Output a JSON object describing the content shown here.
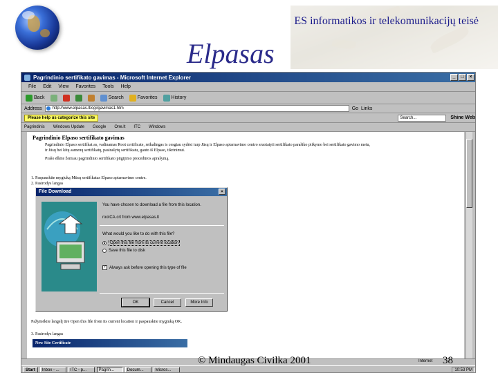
{
  "slide": {
    "header_title": "ES informatikos ir telekomunikacijų teisė",
    "title": "Elpasas",
    "footer_author": "© Mindaugas Civilka 2001",
    "page_number": "38"
  },
  "browser": {
    "window_title": "Pagrindinio sertifikato gavimas - Microsoft Internet Explorer",
    "menu": [
      "File",
      "Edit",
      "View",
      "Favorites",
      "Tools",
      "Help"
    ],
    "toolbar": [
      {
        "label": "Back",
        "icon": "back-arrow-icon"
      },
      {
        "label": "",
        "icon": "forward-arrow-icon"
      },
      {
        "label": "",
        "icon": "stop-icon"
      },
      {
        "label": "",
        "icon": "refresh-icon"
      },
      {
        "label": "",
        "icon": "home-icon"
      },
      {
        "label": "Search",
        "icon": "search-icon"
      },
      {
        "label": "Favorites",
        "icon": "favorites-icon"
      },
      {
        "label": "History",
        "icon": "history-icon"
      }
    ],
    "address_label": "Address",
    "address_url": "http://www.elpasas.lt/cgi/gavimas1.htm",
    "go_label": "Go",
    "links_label": "Links",
    "categorize_button": "Please help us categorize this site",
    "search_placeholder": "Search...",
    "shine_web": "Shine Web",
    "links": [
      "Pagrindinis",
      "Windows Update",
      "Google",
      "One.lt",
      "ITC",
      "Windows"
    ],
    "status_zone": "Internet",
    "colors": {
      "titlebar": "#08246b",
      "accent": "#3a6ea5"
    }
  },
  "content": {
    "heading": "Pagrindinio Elpaso sertifikato gavimas",
    "para_lines": [
      "Pagrindinio Elpaso sertifikat as, vadinamas Root certificate, reikalingas is cesgiau sydėsi turp Jūsų ir Elpaso aptarnavimo centro sruotatyti sertifikato parašiko piikymo bei sertifikato gavimo metu,",
      "ir Jūsų bei kitų asmenų sertifikatų, pasirašytų sertifikatu, gauto iš Elpaso, tikrinimui.",
      "Prašo ėlkite žemiau pagrindinio sertifikato piigijimo procedūros aprašymą."
    ],
    "step1": "1. Paspauskite mygtuką Mūsų sertifikatas Elpaso aptarnavimo centre.",
    "step2": "2. Pasirodys langas",
    "instruction": "Pažymėkite langelį tire Open this file from its current location ir paspauskite mygtuką OK.",
    "step3": "3. Pasirodys langas",
    "new_cert_title": "New Site Certificate"
  },
  "dialog": {
    "title": "File Download",
    "prompt": "You have chosen to download a file from this location.",
    "file": "rootCA.crt from www.elpasas.lt",
    "question": "What would you like to do with this file?",
    "option_open": "Open this file from its current location",
    "option_save": "Save this file to disk",
    "checkbox": "Always ask before opening this type of file",
    "btn_ok": "OK",
    "btn_cancel": "Cancel",
    "btn_more": "More Info"
  },
  "taskbar": {
    "start": "Start",
    "tasks": [
      "Inbox - ...",
      "ITC - p...",
      "Pagrin...",
      "Docum...",
      "Micros..."
    ],
    "clock": "10:53 PM"
  }
}
